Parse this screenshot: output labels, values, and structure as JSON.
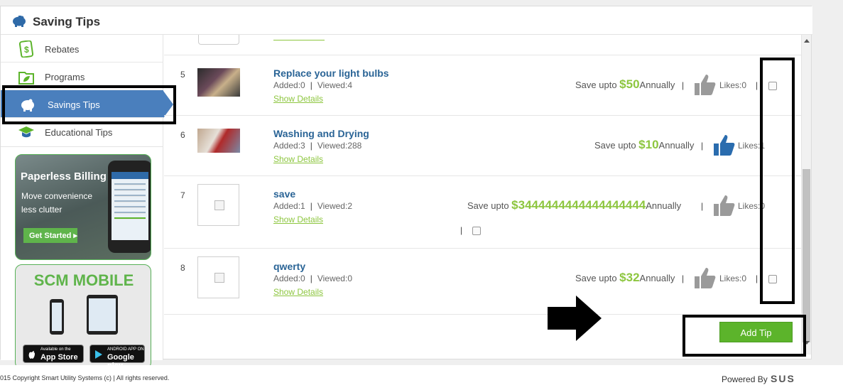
{
  "header": {
    "title": "Saving Tips"
  },
  "sidebar": {
    "items": [
      {
        "label": "Rebates"
      },
      {
        "label": "Programs"
      },
      {
        "label": "Savings Tips"
      },
      {
        "label": "Educational Tips"
      }
    ],
    "promo_billing": {
      "heading": "Paperless Billing",
      "line1": "Move convenience",
      "line2": "less clutter",
      "button": "Get Started"
    },
    "promo_mobile": {
      "heading": "SCM MOBILE",
      "appstore_small": "Available on the",
      "appstore_big": "App Store",
      "google_small": "ANDROID APP ON",
      "google_big": "Google play"
    }
  },
  "tips": [
    {
      "num": "5",
      "title": "Replace your light bulbs",
      "added": "Added:0",
      "viewed": "Viewed:4",
      "details": "Show Details",
      "save_prefix": "Save upto",
      "amount": "$50",
      "save_suffix": "Annually",
      "likes": "Likes:0",
      "liked": false
    },
    {
      "num": "6",
      "title": "Washing and Drying",
      "added": "Added:3",
      "viewed": "Viewed:288",
      "details": "Show Details",
      "save_prefix": "Save upto",
      "amount": "$10",
      "save_suffix": "Annually",
      "likes": "Likes:1",
      "liked": true
    },
    {
      "num": "7",
      "title": "save",
      "added": "Added:1",
      "viewed": "Viewed:2",
      "details": "Show Details",
      "save_prefix": "Save upto",
      "amount": "$3444444444444444444",
      "save_suffix": "Annually",
      "likes": "Likes:0",
      "liked": false
    },
    {
      "num": "8",
      "title": "qwerty",
      "added": "Added:0",
      "viewed": "Viewed:0",
      "details": "Show Details",
      "save_prefix": "Save upto",
      "amount": "$32",
      "save_suffix": "Annually",
      "likes": "Likes:0",
      "liked": false
    }
  ],
  "pipe": "|",
  "add_tip": "Add Tip",
  "footer": {
    "copyright": "015 Copyright Smart Utility Systems (c) | All rights reserved.",
    "powered_by": "Powered By",
    "logo_text": "SUS"
  },
  "colors": {
    "accent_blue": "#4a7fbd",
    "green": "#8dc63f",
    "button_green": "#5cb42b",
    "title_blue": "#2a6496"
  }
}
